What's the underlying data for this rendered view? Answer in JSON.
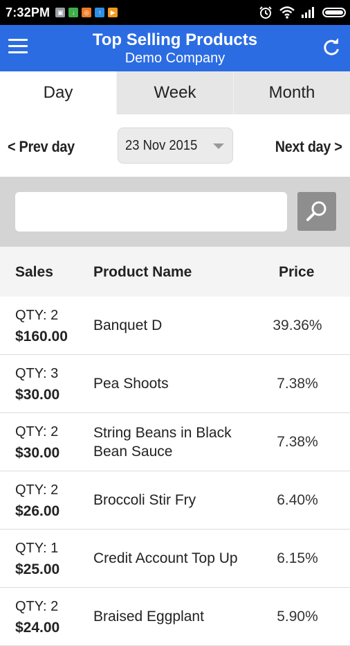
{
  "status_bar": {
    "time": "7:32PM",
    "notification_icons": [
      {
        "name": "sim-notification-icon",
        "color": "#9aa0a6"
      },
      {
        "name": "download-notification-icon",
        "color": "#3fae49"
      },
      {
        "name": "app-notification-icon",
        "color": "#f07a24"
      },
      {
        "name": "upload-notification-icon",
        "color": "#2f8de4"
      },
      {
        "name": "play-notification-icon",
        "color": "#f39a1e"
      }
    ],
    "right_icons": [
      "alarm-icon",
      "wifi-icon",
      "signal-icon",
      "battery-icon"
    ]
  },
  "app_bar": {
    "title": "Top Selling Products",
    "subtitle": "Demo Company",
    "color": "#2b6ce3",
    "left_icon": "menu-icon",
    "right_icon": "refresh-icon"
  },
  "tabs": [
    {
      "label": "Day",
      "active": true
    },
    {
      "label": "Week",
      "active": false
    },
    {
      "label": "Month",
      "active": false
    }
  ],
  "date_nav": {
    "prev_label": "< Prev day",
    "date_value": "23 Nov 2015",
    "next_label": "Next day >"
  },
  "search": {
    "value": "",
    "placeholder": "",
    "button_icon": "search-icon"
  },
  "table": {
    "headers": {
      "sales": "Sales",
      "name": "Product Name",
      "price": "Price"
    },
    "rows": [
      {
        "qty": "QTY: 2",
        "amount": "$160.00",
        "name": "Banquet D",
        "price": "39.36%"
      },
      {
        "qty": "QTY: 3",
        "amount": "$30.00",
        "name": "Pea Shoots",
        "price": "7.38%"
      },
      {
        "qty": "QTY: 2",
        "amount": "$30.00",
        "name": "String Beans in Black Bean Sauce",
        "price": "7.38%"
      },
      {
        "qty": "QTY: 2",
        "amount": "$26.00",
        "name": "Broccoli Stir Fry",
        "price": "6.40%"
      },
      {
        "qty": "QTY: 1",
        "amount": "$25.00",
        "name": "Credit Account Top Up",
        "price": "6.15%"
      },
      {
        "qty": "QTY: 2",
        "amount": "$24.00",
        "name": "Braised Eggplant",
        "price": "5.90%"
      }
    ]
  }
}
